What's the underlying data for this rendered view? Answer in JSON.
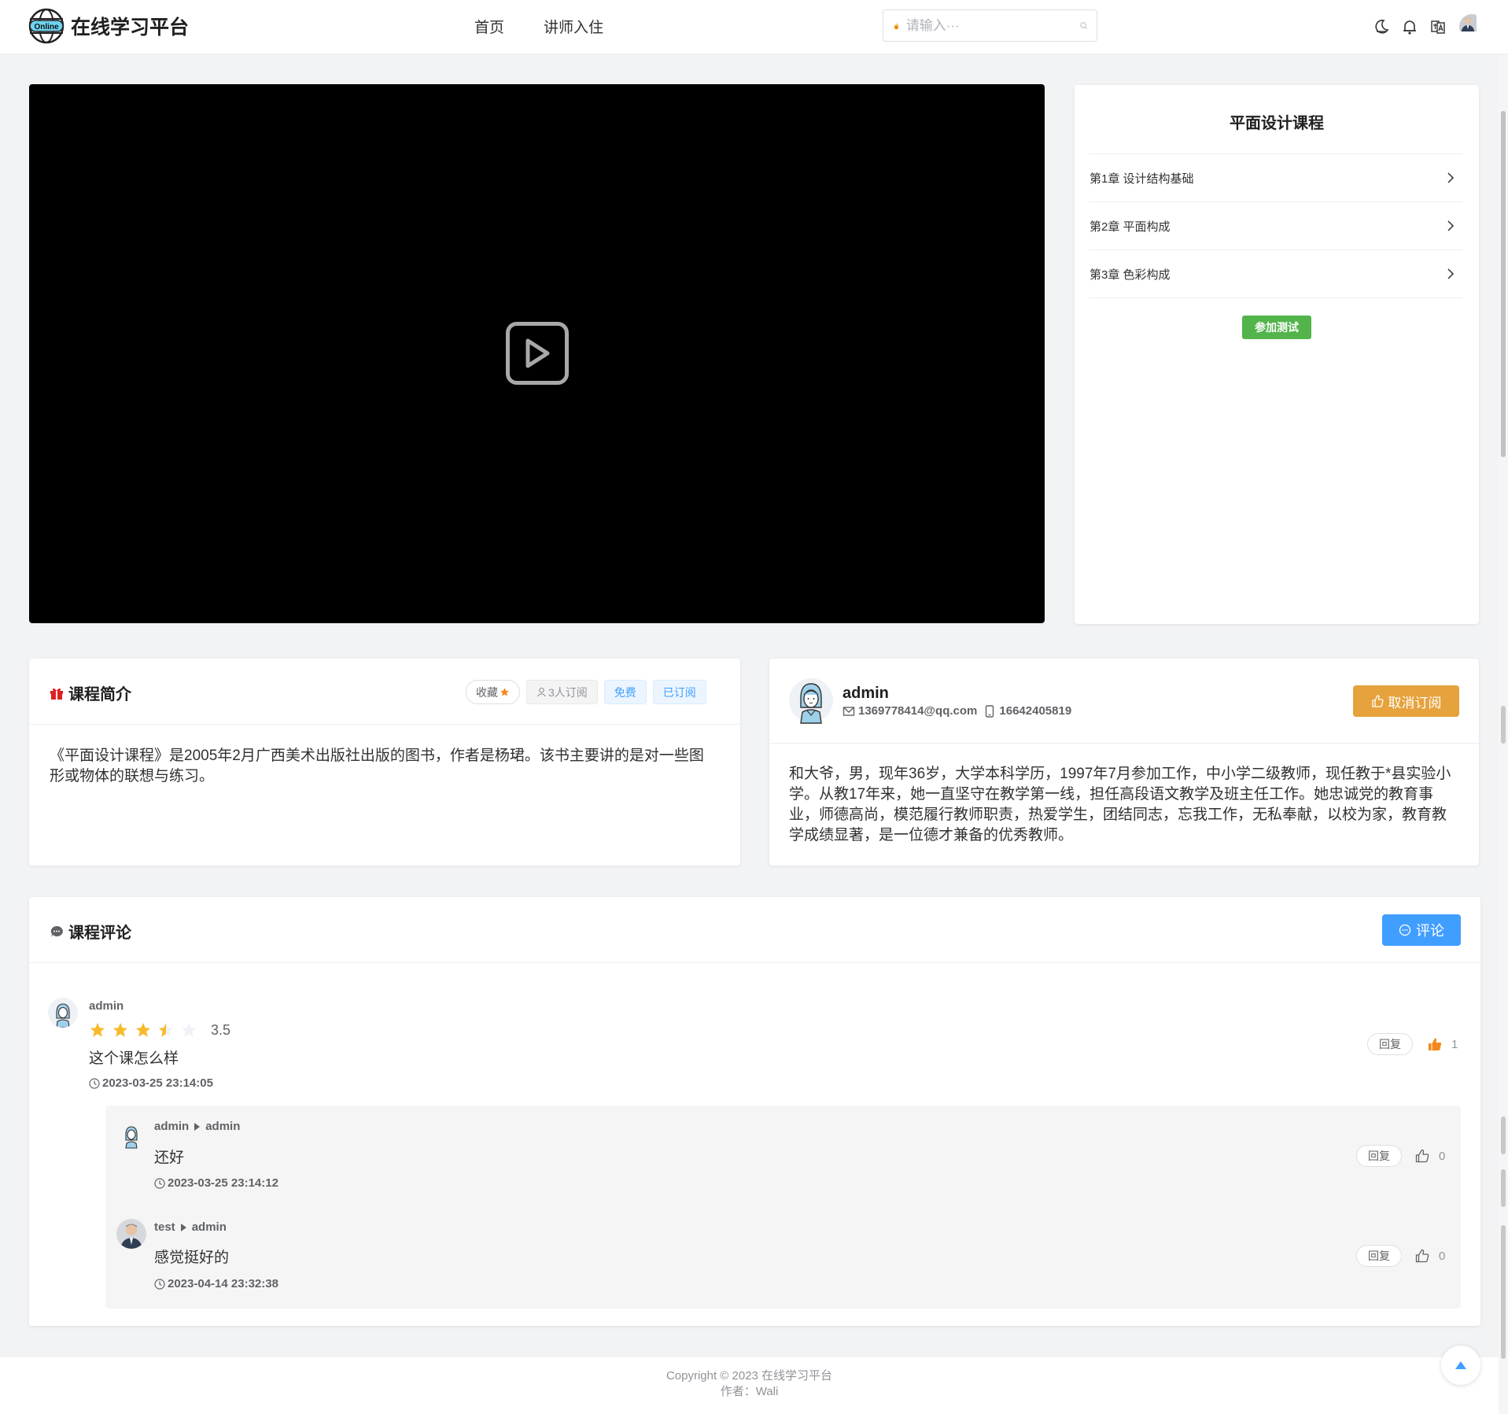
{
  "header": {
    "logo_badge": "Online",
    "site_name": "在线学习平台",
    "nav": [
      "首页",
      "讲师入住"
    ],
    "search_placeholder": "请输入···"
  },
  "course": {
    "title": "平面设计课程",
    "chapters": [
      "第1章 设计结构基础",
      "第2章 平面构成",
      "第3章 色彩构成"
    ],
    "exam_label": "参加测试"
  },
  "intro": {
    "title": "课程简介",
    "tags": {
      "favorite": "收藏",
      "subscribers": "3人订阅",
      "free": "免费",
      "subscribed": "已订阅"
    },
    "text": "《平面设计课程》是2005年2月广西美术出版社出版的图书，作者是杨珺。该书主要讲的是对一些图形或物体的联想与练习。"
  },
  "teacher": {
    "name": "admin",
    "email": "1369778414@qq.com",
    "phone": "16642405819",
    "unsubscribe_label": "取消订阅",
    "bio": "和大爷，男，现年36岁，大学本科学历，1997年7月参加工作，中小学二级教师，现任教于*县实验小学。从教17年来，她一直坚守在教学第一线，担任高段语文教学及班主任工作。她忠诚党的教育事业，师德高尚，模范履行教师职责，热爱学生，团结同志，忘我工作，无私奉献，以校为家，教育教学成绩显著，是一位德才兼备的优秀教师。"
  },
  "comments": {
    "title": "课程评论",
    "comment_label": "评论",
    "reply_label": "回复",
    "main": {
      "user": "admin",
      "rating": 3.5,
      "rating_text": "3.5",
      "text": "这个课怎么样",
      "time": "2023-03-25 23:14:05",
      "likes": "1"
    },
    "replies": [
      {
        "user": "admin",
        "to": "admin",
        "text": "还好",
        "time": "2023-03-25 23:14:12",
        "likes": "0"
      },
      {
        "user": "test",
        "to": "admin",
        "text": "感觉挺好的",
        "time": "2023-04-14 23:32:38",
        "likes": "0"
      }
    ]
  },
  "footer": {
    "copyright": "Copyright © 2023 在线学习平台",
    "author": "作者：Wali"
  },
  "colors": {
    "primary": "#409eff",
    "warning": "#e6a23c",
    "success": "#52b44b",
    "star": "#f7ba2a"
  }
}
